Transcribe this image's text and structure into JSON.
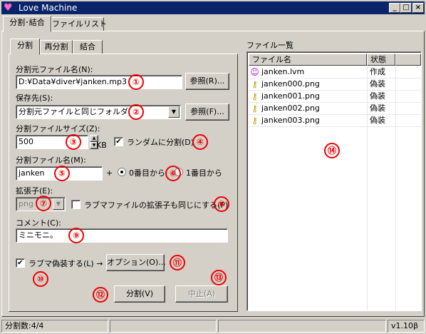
{
  "window": {
    "title": "Love Machine",
    "app_icon": "heart-icon",
    "controls": {
      "minimize": "_",
      "maximize": "□",
      "close": "×"
    }
  },
  "outer_tabs": [
    {
      "label": "分割･結合",
      "active": true
    },
    {
      "label": "ファイルリスト",
      "active": false
    }
  ],
  "inner_tabs": [
    {
      "label": "分割",
      "active": true
    },
    {
      "label": "再分割",
      "active": false
    },
    {
      "label": "結合",
      "active": false
    }
  ],
  "split": {
    "source_label": "分割元ファイル名(N):",
    "source_value": "D:¥Data¥diver¥janken.mp3",
    "browse1_label": "参照(R)...",
    "dest_label": "保存先(S):",
    "dest_value": "分割元ファイルと同じフォルダ",
    "browse2_label": "参照(F)...",
    "size_label": "分割ファイルサイズ(Z):",
    "size_value": "500",
    "size_unit": "KB",
    "random_label": "ランダムに分割(D)",
    "random_checked": true,
    "name_label": "分割ファイル名(M):",
    "name_value": "janken",
    "plus": "+",
    "radio0_label": "0番目から",
    "radio1_label": "1番目から",
    "ext_label": "拡張子(E):",
    "ext_value": "png",
    "same_ext_label": "ラブマファイルの拡張子も同じにする(P)",
    "same_ext_checked": false,
    "comment_label": "コメント(C):",
    "comment_value": "ミニモニ。",
    "disguise_label": "ラブマ偽装する(L) →",
    "disguise_checked": true,
    "options_label": "オプション(O)...",
    "split_button": "分割(V)",
    "stop_button": "中止(A)"
  },
  "markers": [
    "①",
    "②",
    "③",
    "④",
    "⑤",
    "⑥",
    "⑦",
    "⑧",
    "⑨",
    "⑩",
    "⑪",
    "⑫",
    "⑬",
    "⑭"
  ],
  "file_list": {
    "title": "ファイル一覧",
    "col_name": "ファイル名",
    "col_state": "状態",
    "rows": [
      {
        "name": "janken.lvm",
        "state": "作成",
        "icon": "love-machine-file-icon"
      },
      {
        "name": "janken000.png",
        "state": "偽装",
        "icon": "key-icon"
      },
      {
        "name": "janken001.png",
        "state": "偽装",
        "icon": "key-icon"
      },
      {
        "name": "janken002.png",
        "state": "偽装",
        "icon": "key-icon"
      },
      {
        "name": "janken003.png",
        "state": "偽装",
        "icon": "key-icon"
      }
    ]
  },
  "statusbar": {
    "count": "分割数:4/4",
    "version": "v1.10β"
  },
  "colors": {
    "titlebar": "#0a246a",
    "marker": "#ee0000",
    "face": "#d4d0c8"
  }
}
